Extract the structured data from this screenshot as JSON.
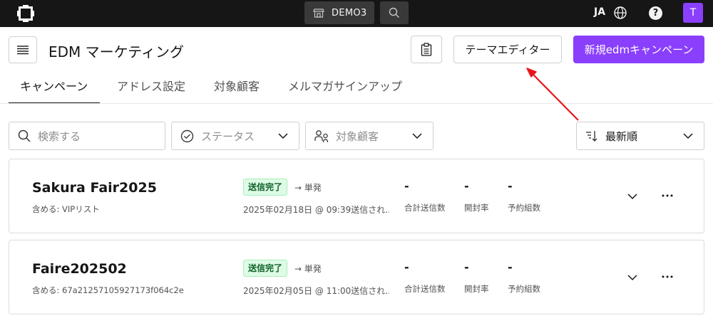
{
  "topbar": {
    "store_label": "DEMO3",
    "language": "JA",
    "help_label": "?",
    "avatar_initial": "T"
  },
  "header": {
    "title": "EDM マーケティング",
    "theme_editor_label": "テーマエディター",
    "new_campaign_label": "新規edmキャンペーン"
  },
  "tabs": [
    {
      "label": "キャンペーン",
      "active": true
    },
    {
      "label": "アドレス設定",
      "active": false
    },
    {
      "label": "対象顧客",
      "active": false
    },
    {
      "label": "メルマガサインアップ",
      "active": false
    }
  ],
  "filters": {
    "search_placeholder": "検索する",
    "status_label": "ステータス",
    "audience_label": "対象顧客",
    "sort_label": "最新順"
  },
  "campaigns": [
    {
      "name": "Sakura Fair2025",
      "includes": "含める: VIPリスト",
      "status": "送信完了",
      "type": "→ 単発",
      "date": "2025年02月18日 @ 09:39送信され...",
      "total_sent": "-",
      "total_sent_label": "合計送信数",
      "open_rate": "-",
      "open_rate_label": "開封率",
      "bookings": "-",
      "bookings_label": "予約組数"
    },
    {
      "name": "Faire202502",
      "includes": "含める: 67a21257105927173f064c2e",
      "status": "送信完了",
      "type": "→ 単発",
      "date": "2025年02月05日 @ 11:00送信され...",
      "total_sent": "-",
      "total_sent_label": "合計送信数",
      "open_rate": "-",
      "open_rate_label": "開封率",
      "bookings": "-",
      "bookings_label": "予約組数"
    }
  ],
  "colors": {
    "topbar": "#161616",
    "accent": "#8a3ffc",
    "badge_bg": "#defbe6",
    "badge_text": "#0e6027",
    "annotation_arrow": "#e8161b"
  },
  "icons": [
    "logo-icon",
    "store-icon",
    "search-icon",
    "globe-icon",
    "help-icon",
    "menu-icon",
    "clipboard-icon",
    "checkmark-circle-icon",
    "people-icon",
    "sort-icon",
    "chevron-down-icon",
    "overflow-menu-icon"
  ]
}
